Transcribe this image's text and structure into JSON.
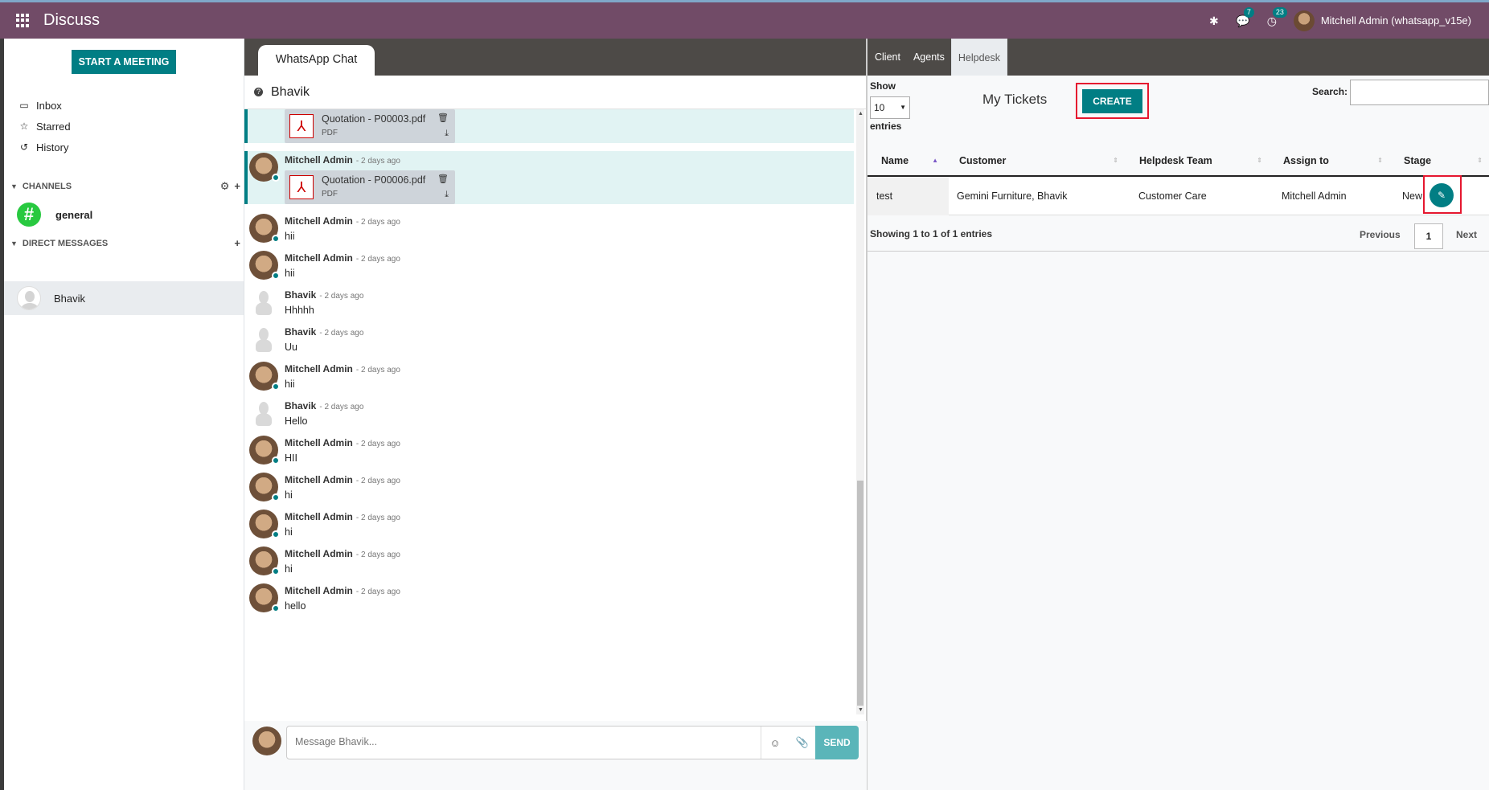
{
  "app": {
    "title": "Discuss"
  },
  "topbar": {
    "messages_count": "7",
    "activities_count": "23",
    "user_label": "Mitchell Admin (whatsapp_v15e)"
  },
  "sidebar": {
    "meeting_button": "START A MEETING",
    "nav": [
      {
        "label": "Inbox",
        "icon": "inbox-icon"
      },
      {
        "label": "Starred",
        "icon": "star-icon"
      },
      {
        "label": "History",
        "icon": "history-icon"
      }
    ],
    "channels_header": "CHANNELS",
    "channel_general": "general",
    "dm_header": "DIRECT MESSAGES",
    "dm_bhavik": "Bhavik"
  },
  "chat": {
    "tab_label": "WhatsApp Chat",
    "partner": "Bhavik",
    "attachments": [
      {
        "name": "Quotation - P00003.pdf",
        "ext": "PDF"
      },
      {
        "author": "Mitchell Admin",
        "time": "- 2 days ago",
        "name": "Quotation - P00006.pdf",
        "ext": "PDF"
      }
    ],
    "messages": [
      {
        "author": "Mitchell Admin",
        "time": "- 2 days ago",
        "text": "hii"
      },
      {
        "author": "Mitchell Admin",
        "time": "- 2 days ago",
        "text": "hii"
      },
      {
        "author": "Bhavik",
        "time": "- 2 days ago",
        "text": "Hhhhh"
      },
      {
        "author": "Bhavik",
        "time": "- 2 days ago",
        "text": "Uu"
      },
      {
        "author": "Mitchell Admin",
        "time": "- 2 days ago",
        "text": "hii"
      },
      {
        "author": "Bhavik",
        "time": "- 2 days ago",
        "text": "Hello"
      },
      {
        "author": "Mitchell Admin",
        "time": "- 2 days ago",
        "text": "HII"
      },
      {
        "author": "Mitchell Admin",
        "time": "- 2 days ago",
        "text": "hi"
      },
      {
        "author": "Mitchell Admin",
        "time": "- 2 days ago",
        "text": "hi"
      },
      {
        "author": "Mitchell Admin",
        "time": "- 2 days ago",
        "text": "hi"
      },
      {
        "author": "Mitchell Admin",
        "time": "- 2 days ago",
        "text": "hello"
      }
    ],
    "composer_placeholder": "Message Bhavik...",
    "send_label": "SEND"
  },
  "helpdesk": {
    "tabs": [
      "Client",
      "Agents",
      "Helpdesk"
    ],
    "show_label": "Show",
    "page_size": "10",
    "entries_label": "entries",
    "title": "My Tickets",
    "create_label": "CREATE",
    "search_label": "Search:",
    "columns": [
      "Name",
      "Customer",
      "Helpdesk Team",
      "Assign to",
      "Stage"
    ],
    "rows": [
      {
        "name": "test",
        "customer": "Gemini Furniture, Bhavik",
        "team": "Customer Care",
        "assignee": "Mitchell Admin",
        "stage": "New"
      }
    ],
    "info_text": "Showing 1 to 1 of 1 entries",
    "prev_label": "Previous",
    "current_page": "1",
    "next_label": "Next"
  },
  "colors": {
    "topbar": "#714B67",
    "accent": "#017e84",
    "highlight_frame": "#e5172f"
  }
}
